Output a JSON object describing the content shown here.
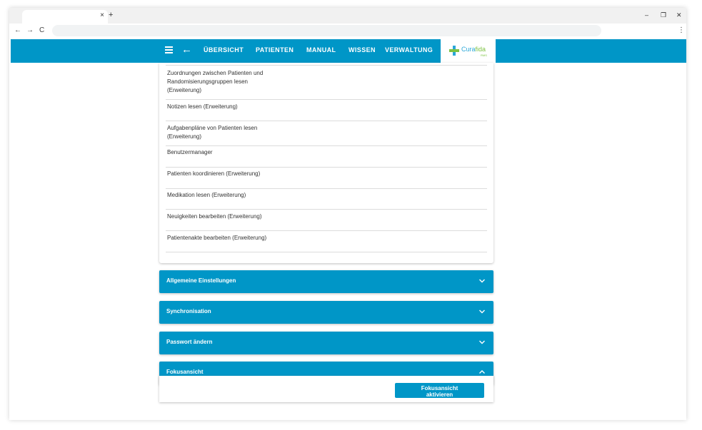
{
  "browser": {
    "tab_close": "×",
    "new_tab": "+",
    "minimize": "–",
    "restore": "❐",
    "close": "✕",
    "back": "←",
    "forward": "→",
    "reload": "C",
    "menu": "⋮"
  },
  "nav": {
    "items": [
      "ÜBERSICHT",
      "PATIENTEN",
      "MANUAL",
      "WISSEN",
      "VERWALTUNG"
    ]
  },
  "logo": {
    "part1": "Cura",
    "part2": "fida",
    "sub": "RMS"
  },
  "permissions": [
    "Zuordnungen zwischen Patienten und Randomisierungsgruppen lesen (Erweiterung)",
    "Notizen lesen (Erweiterung)",
    "Aufgabenpläne von Patienten lesen (Erweiterung)",
    "Benutzermanager",
    "Patienten koordinieren (Erweiterung)",
    "Medikation lesen (Erweiterung)",
    "Neuigkeiten bearbeiten (Erweiterung)",
    "Patientenakte bearbeiten (Erweiterung)"
  ],
  "panels": {
    "general": "Allgemeine Einstellungen",
    "sync": "Synchronisation",
    "password": "Passwort ändern",
    "focus": "Fokusansicht"
  },
  "focus": {
    "button_line1": "Fokusansicht",
    "button_line2": "aktivieren"
  },
  "colors": {
    "primary": "#0096c7"
  }
}
